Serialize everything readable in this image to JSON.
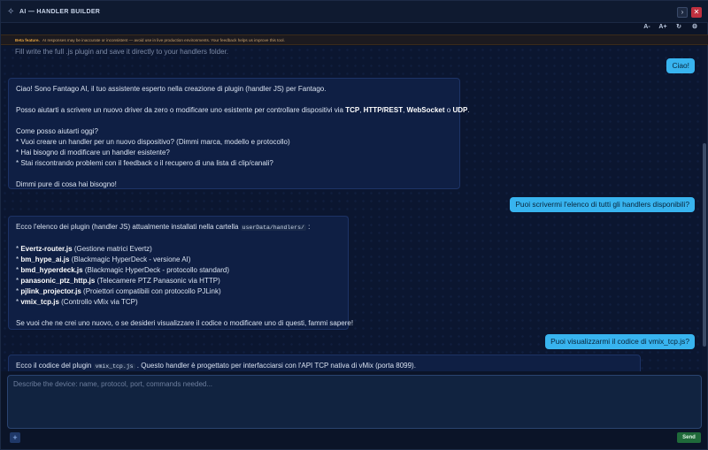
{
  "window": {
    "title": "AI — HANDLER BUILDER",
    "title_icon": "✧",
    "collapse_icon": "›",
    "close_icon": "✕"
  },
  "toolbar": {
    "font_decrease": "A-",
    "font_increase": "A+",
    "refresh_icon": "↻",
    "settings_icon": "⚙"
  },
  "banner": {
    "label": "Beta feature.",
    "text": "AI responses may be inaccurate or inconsistent — avoid use in live production environments. Your feedback helps us improve this tool."
  },
  "chat": {
    "partial_line": "Fill write the full .js plugin and save it directly to your handlers folder.",
    "messages": [
      {
        "role": "user",
        "text": "Ciao!"
      },
      {
        "role": "ai",
        "intro": "Ciao! Sono Fantago AI, il tuo assistente esperto nella creazione di plugin (handler JS) per Fantago.",
        "p2_prefix": "Posso aiutarti a scrivere un nuovo driver da zero o modificare uno esistente per controllare dispositivi via ",
        "p2_tcp": "TCP",
        "p2_sep1": ", ",
        "p2_http": "HTTP/REST",
        "p2_sep2": ", ",
        "p2_ws": "WebSocket",
        "p2_sep3": " o ",
        "p2_udp": "UDP",
        "p2_end": ".",
        "q_title": "Come posso aiutarti oggi?",
        "q1": "* Vuoi creare un handler per un nuovo dispositivo? (Dimmi marca, modello e protocollo)",
        "q2": "* Hai bisogno di modificare un handler esistente?",
        "q3": "* Stai riscontrando problemi con il feedback o il recupero di una lista di clip/canali?",
        "closing": "Dimmi pure di cosa hai bisogno!"
      },
      {
        "role": "user",
        "text": "Puoi scrivermi l'elenco di tutti gli handlers disponibili?"
      },
      {
        "role": "ai",
        "intro_prefix": "Ecco l'elenco dei plugin (handler JS) attualmente installati nella cartella ",
        "intro_code": "userData/handlers/",
        "intro_suffix": " :",
        "handlers": [
          {
            "name": "Evertz-router.js",
            "desc": " (Gestione matrici Evertz)"
          },
          {
            "name": "bm_hype_ai.js",
            "desc": " (Blackmagic HyperDeck - versione AI)"
          },
          {
            "name": "bmd_hyperdeck.js",
            "desc": " (Blackmagic HyperDeck - protocollo standard)"
          },
          {
            "name": "panasonic_ptz_http.js",
            "desc": " (Telecamere PTZ Panasonic via HTTP)"
          },
          {
            "name": "pjlink_projector.js",
            "desc": " (Proiettori compatibili con protocollo PJLink)"
          },
          {
            "name": "vmix_tcp.js",
            "desc": " (Controllo vMix via TCP)"
          }
        ],
        "closing": "Se vuoi che ne crei uno nuovo, o se desideri visualizzare il codice o modificare uno di questi, fammi sapere!"
      },
      {
        "role": "user",
        "text": "Puoi visualizzarmi il codice di vmix_tcp.js?"
      },
      {
        "role": "ai",
        "prefix": "Ecco il codice del plugin ",
        "code": "vmix_tcp.js",
        "suffix": " . Questo handler è progettato per interfacciarsi con l'API TCP nativa di vMix (porta 8099)."
      }
    ]
  },
  "composer": {
    "placeholder": "Describe the device: name, protocol, port, commands needed...",
    "value": ""
  },
  "actions": {
    "add_icon": "+",
    "send_label": "Send"
  }
}
